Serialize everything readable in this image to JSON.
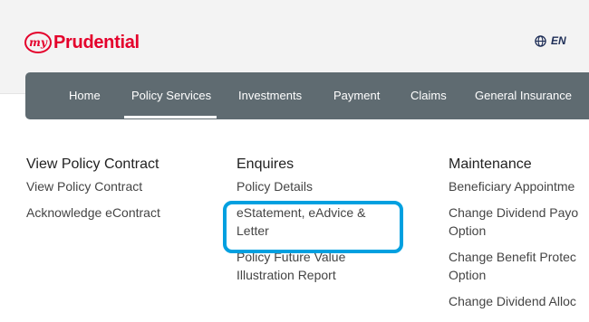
{
  "header": {
    "logo_my": "my",
    "logo_text": "Prudential",
    "lang_label": "EN",
    "lang_icon": "globe-icon"
  },
  "nav": {
    "items": [
      "Home",
      "Policy Services",
      "Investments",
      "Payment",
      "Claims",
      "General Insurance"
    ],
    "active": "Policy Services"
  },
  "columns": [
    {
      "title": "View Policy Contract",
      "links": [
        [
          "View Policy Contract"
        ],
        [
          "Acknowledge eContract"
        ]
      ]
    },
    {
      "title": "Enquires",
      "links": [
        [
          "Policy Details"
        ],
        [
          "eStatement, eAdvice &",
          "Letter"
        ],
        [
          "Policy Future Value",
          "Illustration Report"
        ]
      ]
    },
    {
      "title": "Maintenance",
      "links": [
        [
          "Beneficiary Appointme"
        ],
        [
          "Change Dividend Payo",
          "Option"
        ],
        [
          "Change Benefit Protec",
          "Option"
        ],
        [
          "Change Dividend Alloc"
        ]
      ]
    }
  ],
  "colors": {
    "brand": "#e4002b",
    "nav_bg": "#5f6b71",
    "highlight": "#00a0e0"
  }
}
